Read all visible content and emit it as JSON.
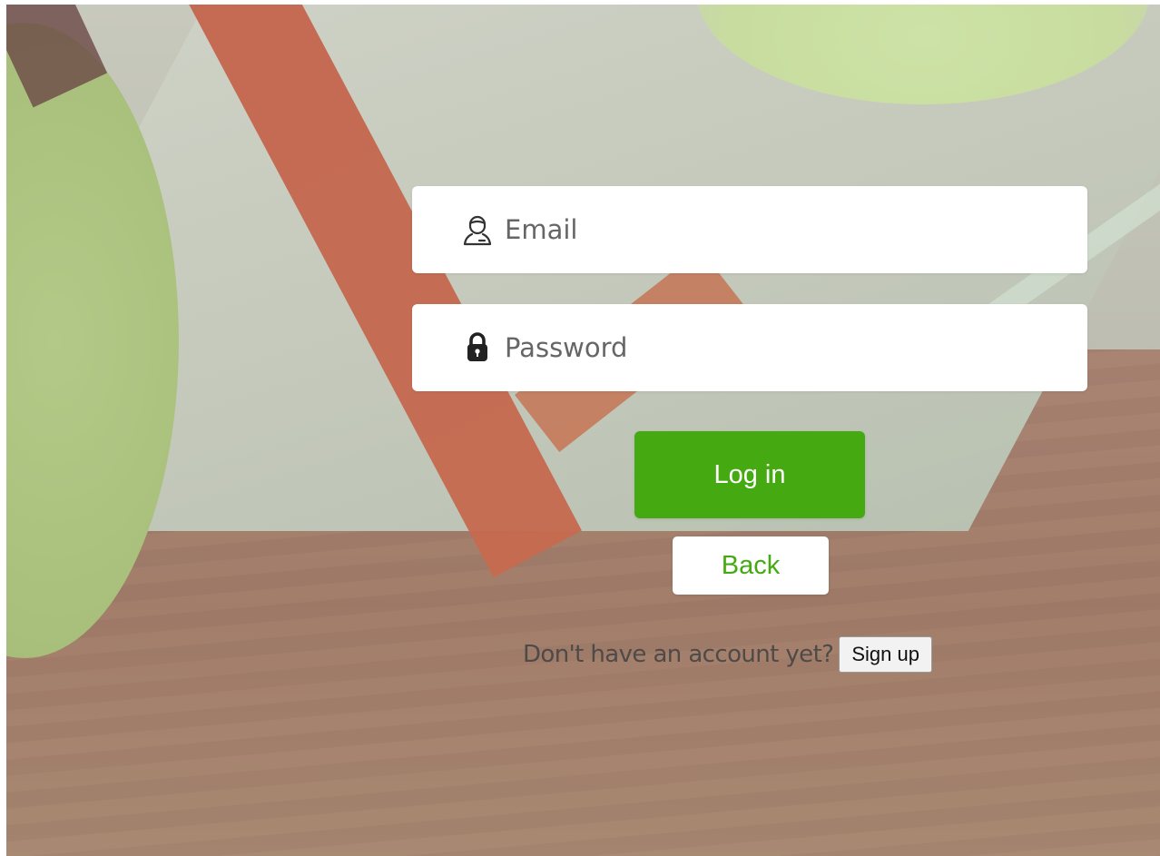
{
  "login_form": {
    "email": {
      "icon": "user-icon",
      "placeholder": "Email",
      "value": ""
    },
    "password": {
      "icon": "lock-icon",
      "placeholder": "Password",
      "value": ""
    },
    "login_button_label": "Log in",
    "back_button_label": "Back",
    "signup_prompt": "Don't have an account yet?",
    "signup_button_label": "Sign up"
  },
  "colors": {
    "primary_green": "#45aa11",
    "field_background": "#ffffff",
    "prompt_text": "#4e4a48"
  }
}
